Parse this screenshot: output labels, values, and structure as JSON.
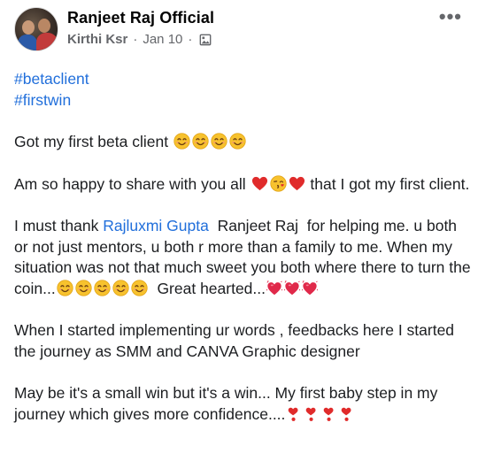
{
  "post": {
    "page_name": "Ranjeet Raj Official",
    "author": "Kirthi Ksr",
    "separator": "·",
    "date": "Jan 10",
    "more_label": "•••",
    "hashtags": [
      "#betaclient",
      "#firstwin"
    ],
    "p1": "Got my first beta client",
    "p2_a": "Am so happy to share with you all",
    "p2_b": "that I got my first client.",
    "p3_a": "I must thank",
    "p3_mention1": "Rajluxmi Gupta",
    "p3_mention2": "Ranjeet Raj",
    "p3_b": "for helping me. u both or not just mentors, u both r more than a family to me. When my situation was not that much sweet you both where there to turn the coin...",
    "p3_c": "Great hearted...",
    "p4": "When I started implementing ur words , feedbacks here I started the journey as SMM and CANVA Graphic designer",
    "p5": "May be it's a small win but it's a win... My first baby step in my journey which gives more confidence...."
  },
  "icons": {
    "audience": "photo-icon",
    "smile": "smiling-face-emoji",
    "heart": "red-heart-emoji",
    "kiss": "face-blowing-kiss-emoji",
    "sparkling_heart": "sparkling-heart-emoji",
    "heart_exclamation": "heart-exclamation-emoji"
  },
  "colors": {
    "link": "#216fdb",
    "meta": "#65676b",
    "text": "#1c1e21"
  }
}
